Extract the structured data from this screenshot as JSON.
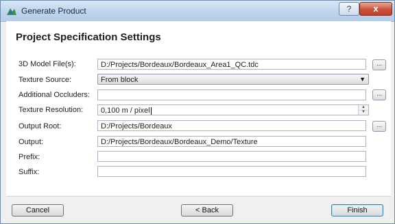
{
  "window": {
    "title": "Generate Product",
    "help_label": "?",
    "close_label": "x"
  },
  "heading": "Project Specification Settings",
  "fields": [
    {
      "label": "3D Model File(s):",
      "value": "D:/Projects/Bordeaux/Bordeaux_Area1_QC.tdc",
      "browse": "..."
    },
    {
      "label": "Texture Source:",
      "value": "From block",
      "dropdown_icon": "▼"
    },
    {
      "label": "Additional Occluders:",
      "value": "",
      "browse": "..."
    },
    {
      "label": "Texture Resolution:",
      "value": "0,100 m / pixel"
    },
    {
      "label": "Output Root:",
      "value": "D:/Projects/Bordeaux",
      "browse": "..."
    },
    {
      "label": "Output:",
      "value": "D:/Projects/Bordeaux/Bordeaux_Demo/Texture"
    },
    {
      "label": "Prefix:",
      "value": ""
    },
    {
      "label": "Suffix:",
      "value": ""
    }
  ],
  "buttons": {
    "cancel": "Cancel",
    "back": "< Back",
    "finish": "Finish"
  },
  "colors": {
    "titlebar": "#bcd3ec",
    "close_button": "#c9523b",
    "content_bg": "#ffffff",
    "dialog_bg": "#f0f0f0"
  }
}
